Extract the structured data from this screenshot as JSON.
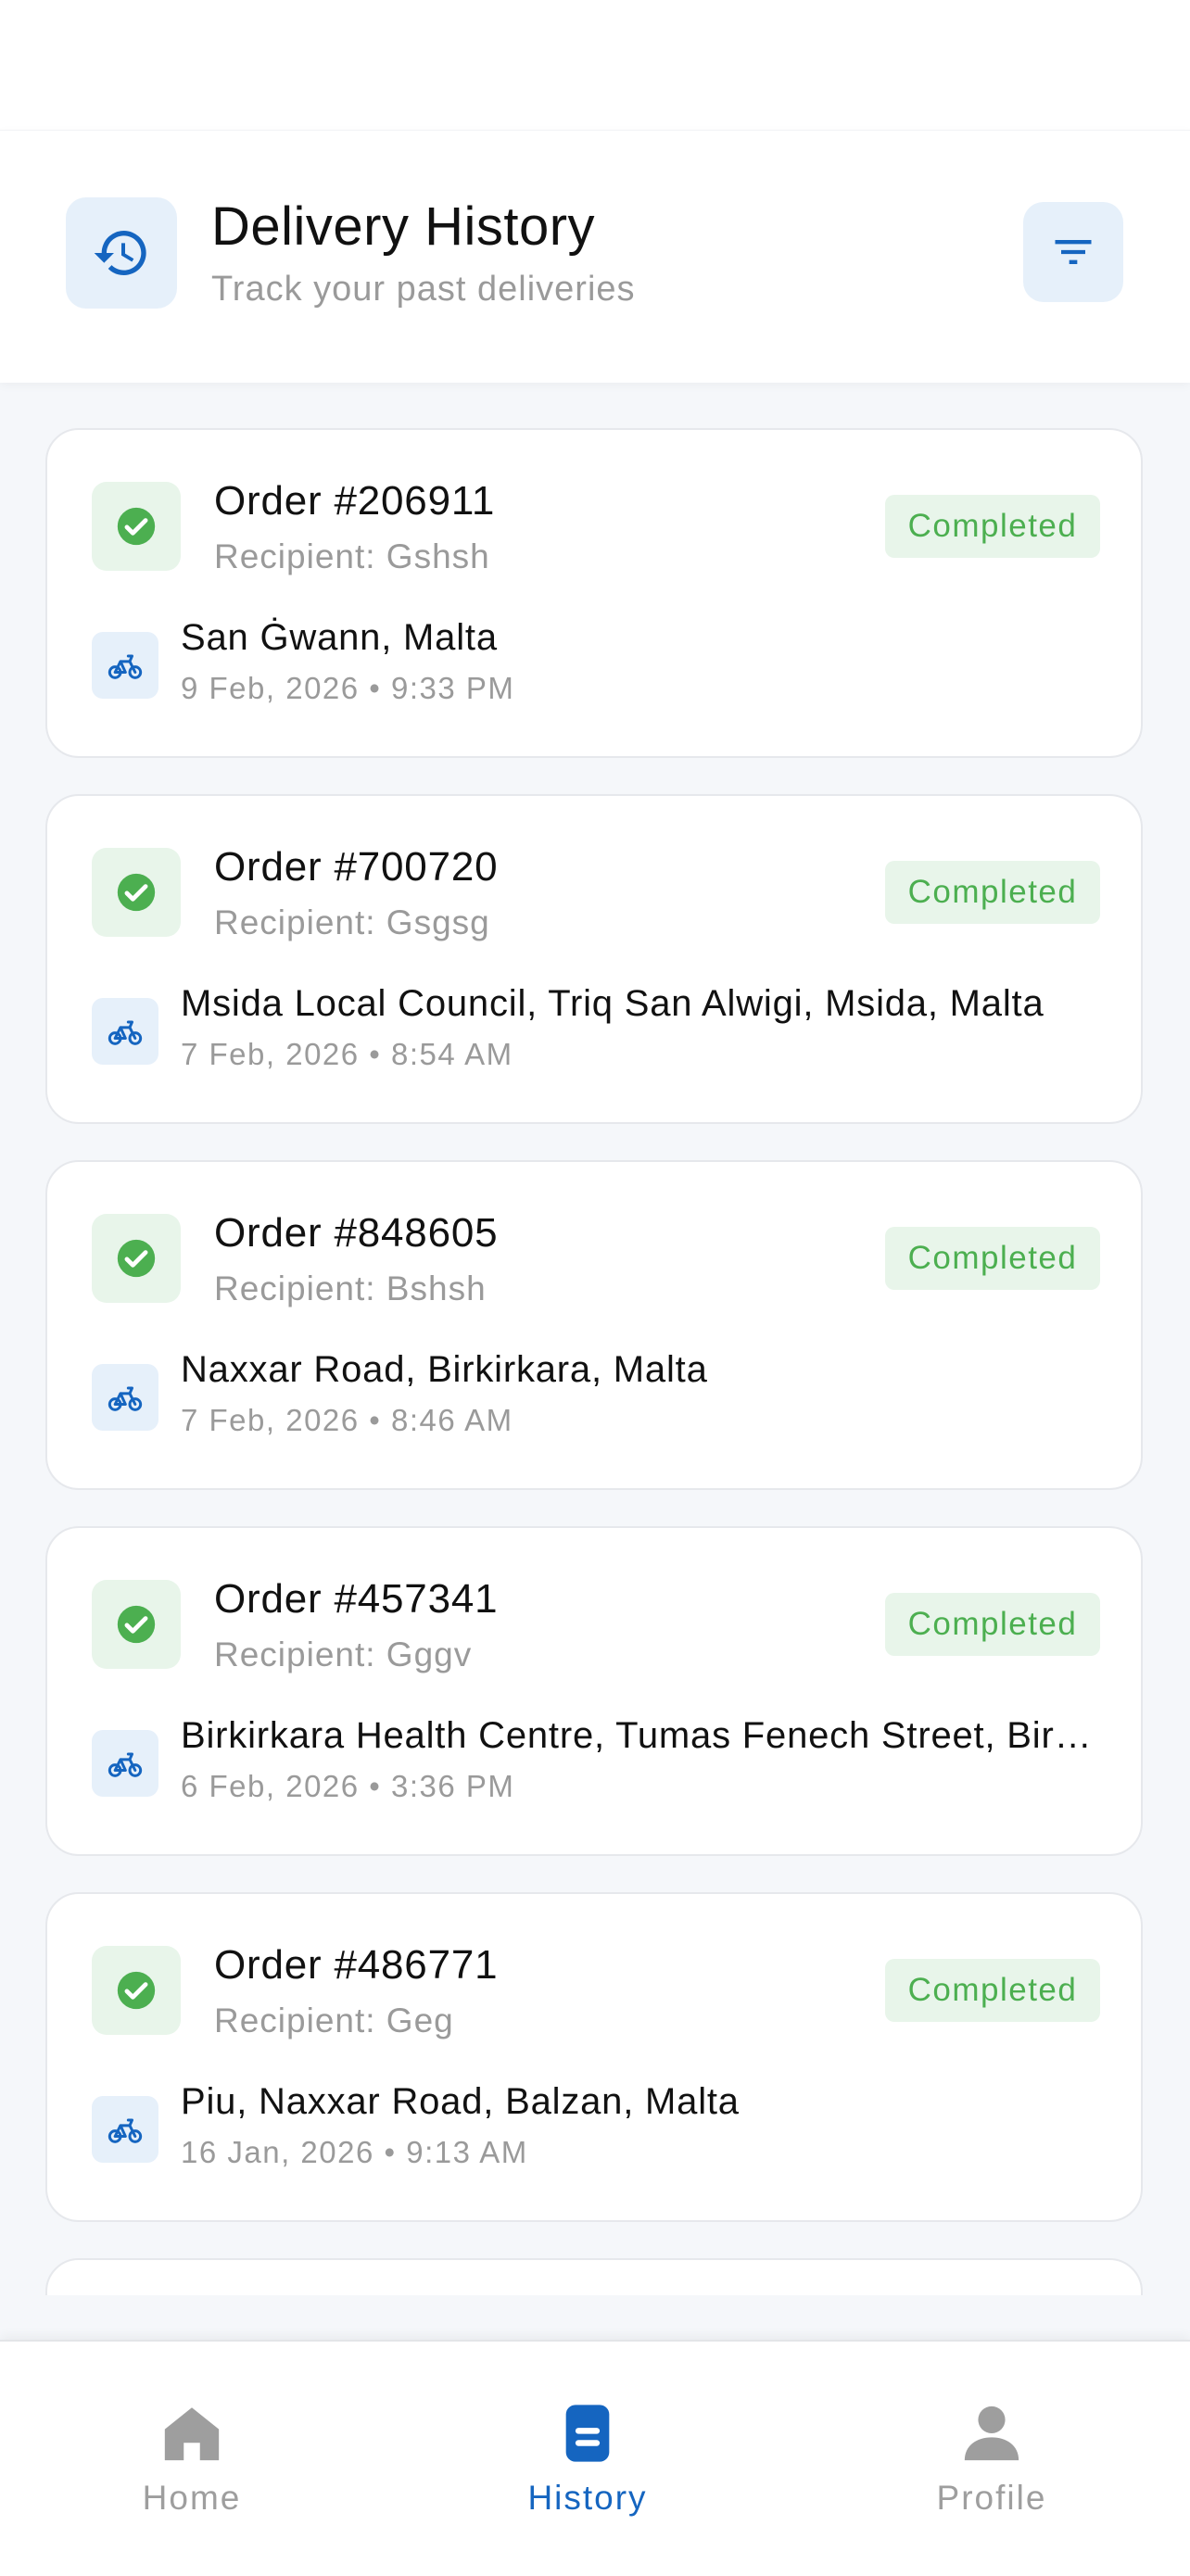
{
  "header": {
    "title": "Delivery History",
    "subtitle": "Track your past deliveries",
    "icon": "history-icon",
    "filter_icon": "filter-icon"
  },
  "orders": [
    {
      "title": "Order #206911",
      "recipient": "Recipient: Gshsh",
      "status": "Completed",
      "address": "San Ġwann, Malta",
      "datetime": "9 Feb, 2026 • 9:33 PM"
    },
    {
      "title": "Order #700720",
      "recipient": "Recipient: Gsgsg",
      "status": "Completed",
      "address": "Msida Local Council, Triq San Alwigi, Msida, Malta",
      "datetime": "7 Feb, 2026 • 8:54 AM"
    },
    {
      "title": "Order #848605",
      "recipient": "Recipient: Bshsh",
      "status": "Completed",
      "address": "Naxxar Road, Birkirkara, Malta",
      "datetime": "7 Feb, 2026 • 8:46 AM"
    },
    {
      "title": "Order #457341",
      "recipient": "Recipient: Gggv",
      "status": "Completed",
      "address": "Birkirkara Health Centre, Tumas Fenech Street, Birkirkara, Malta",
      "datetime": "6 Feb, 2026 • 3:36 PM"
    },
    {
      "title": "Order #486771",
      "recipient": "Recipient: Geg",
      "status": "Completed",
      "address": "Piu, Naxxar Road, Balzan, Malta",
      "datetime": "16 Jan, 2026 • 9:13 AM"
    }
  ],
  "nav": {
    "home": "Home",
    "history": "History",
    "profile": "Profile",
    "active": "history"
  },
  "colors": {
    "accent": "#1565C0",
    "success": "#4CAF50",
    "muted": "#9A9A9A",
    "nav_inactive": "#9E9E9E"
  }
}
